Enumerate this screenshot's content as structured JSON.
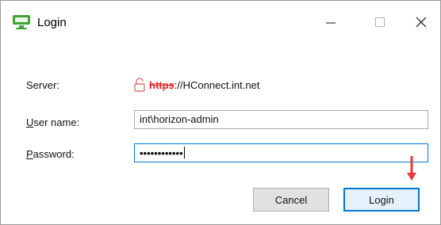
{
  "window": {
    "title": "Login",
    "icon": "monitor-icon",
    "controls": {
      "minimize": "—",
      "maximize": "☐",
      "close": "✕"
    }
  },
  "form": {
    "server_label": "Server:",
    "server_protocol": "https",
    "server_rest": "://HConnect.int.net",
    "user_label_first": "U",
    "user_label_rest": "ser name:",
    "user_value": "int\\horizon-admin",
    "password_label_first": "P",
    "password_label_rest": "assword:",
    "password_mask": "••••••••••••"
  },
  "buttons": {
    "cancel": "Cancel",
    "login": "Login"
  },
  "colors": {
    "accent": "#0078d7",
    "insecure": "#e02424",
    "app_icon": "#3fa535"
  }
}
